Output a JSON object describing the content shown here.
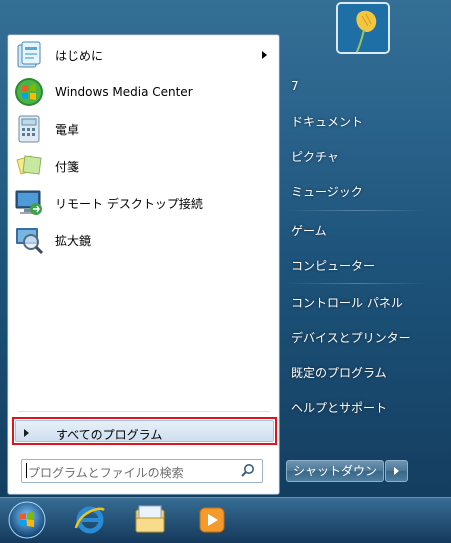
{
  "left_items": [
    {
      "label": "はじめに",
      "icon": "getting-started-icon",
      "has_submenu": true
    },
    {
      "label": "Windows Media Center",
      "icon": "windows-media-center-icon"
    },
    {
      "label": "電卓",
      "icon": "calculator-icon"
    },
    {
      "label": "付箋",
      "icon": "sticky-notes-icon"
    },
    {
      "label": "リモート デスクトップ接続",
      "icon": "remote-desktop-icon"
    },
    {
      "label": "拡大鏡",
      "icon": "magnifier-icon"
    }
  ],
  "all_programs_label": "すべてのプログラム",
  "search": {
    "placeholder": "プログラムとファイルの検索"
  },
  "right_items": [
    {
      "label": "7"
    },
    {
      "label": "ドキュメント"
    },
    {
      "label": "ピクチャ"
    },
    {
      "label": "ミュージック"
    },
    {
      "label": "ゲーム"
    },
    {
      "label": "コンピューター"
    },
    {
      "label": "コントロール パネル"
    },
    {
      "label": "デバイスとプリンター"
    },
    {
      "label": "既定のプログラム"
    },
    {
      "label": "ヘルプとサポート"
    }
  ],
  "shutdown_label": "シャットダウン",
  "taskbar": [
    "start-orb-icon",
    "internet-explorer-icon",
    "windows-explorer-icon",
    "media-player-icon"
  ],
  "colors": {
    "highlight_border": "#e1141b",
    "accent": "#0c5a84"
  }
}
